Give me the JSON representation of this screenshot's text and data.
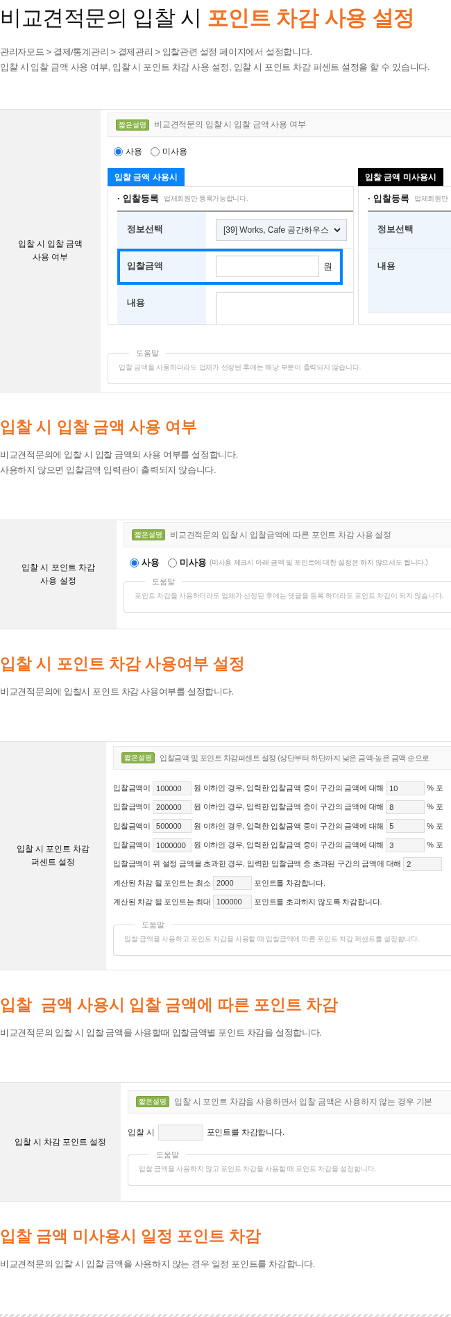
{
  "title": "비교견적문의 입찰 시 **포인트 차감 사용 설정**",
  "intro": [
    "관리자모드 > 결제/통계관리 > 결제관리 > 입찰관련 설정 페이지에서  설정합니다.",
    "입찰 시 입찰 금액 사용 여부, 입찰 시 포인트 차감 사용 설정, 입찰 시 포인트 차감 퍼센트 설정을 할 수 있습니다."
  ],
  "sections": [
    {
      "panel": {
        "kind": "bid_form",
        "label": "입찰 시 입찰 금액\n사용 여부",
        "badge": "짧은설명",
        "summary": "비교견적문의 입찰 시 입찰 금액 사용 여부",
        "options": [
          {
            "label": "사용",
            "selected": true
          },
          {
            "label": "미사용",
            "selected": false
          }
        ],
        "forms": [
          {
            "tab": "입찰 금액 사용시",
            "color": "#0a84ff",
            "title": "· 입찰등록",
            "note": "업체회원만 등록가능합니다.",
            "rows": [
              {
                "kind": "select",
                "label": "정보선택",
                "value": "[39] Works, Cafe 공간하우스",
                "highlighted": false
              },
              {
                "kind": "amount",
                "label": "입찰금액",
                "unit": "원",
                "highlighted": true
              },
              {
                "kind": "textarea",
                "label": "내용",
                "highlighted": false
              }
            ]
          },
          {
            "tab": "입찰 금액 미사용시",
            "color": "#000000",
            "title": "· 입찰등록",
            "note": "업체회원만",
            "rows": [
              {
                "kind": "label",
                "label": "정보선택",
                "highlighted": false
              },
              {
                "kind": "label",
                "label": "내용",
                "highlighted": false
              }
            ]
          }
        ],
        "help": {
          "legend": "도움말",
          "text": "입찰 금액을 사용하더라도 업체가 선정된 후에는 해당 부분이 출력되지 않습니다."
        }
      },
      "heading": "입찰 시 입찰 금액 사용 여부",
      "description": [
        "비교견적문의에 입찰 시 입찰 금액의 사용 여부를 설정합니다.",
        "사용하지 않으면 입찰금액 입력란이 출력되지 않습니다."
      ]
    },
    {
      "panel": {
        "kind": "toggle",
        "label": "입찰 시 포인트 차감\n사용 설정",
        "badge": "짧은설명",
        "summary": "비교견적문의 입찰 시 입찰금액에 따른 포인트 차감 사용 설정",
        "options": [
          {
            "label": "사용",
            "selected": true
          },
          {
            "label": "미사용",
            "selected": false
          }
        ],
        "option_note": "(미사용 체크시 아래 금액 및 포인트에 대한 설정은 하지 않으셔도 됩니다.)",
        "help": {
          "legend": "도움말",
          "text": "포인트 차감을 사용하더라도 업체가 선정된 후에는 댓글을 등록 하더라도 포인트 차감이 되지 않습니다."
        }
      },
      "heading": "입찰 시 포인트 차감 사용여부 설정",
      "description": [
        "비교견적문의에 입찰시 포인트 차감 사용여부를 설정합니다."
      ]
    },
    {
      "panel": {
        "kind": "percent",
        "label": "입찰 시 포인트 차감\n퍼센트 설정",
        "badge": "짧은설명",
        "summary": "입찰금액 및 포인트 차감퍼센트 설정 (상단부터 하단까지 낮은 금액-높은 금액 순으로",
        "lines": [
          {
            "parts": [
              {
                "kind": "text",
                "text": "입찰금액이"
              },
              {
                "kind": "input",
                "value": "100000"
              },
              {
                "kind": "text",
                "text": "원 이하인 경우, 입력한 입찰금액 중이 구간의 금액에 대해"
              },
              {
                "kind": "input",
                "value": "10"
              },
              {
                "kind": "text",
                "text": "% 포"
              }
            ]
          },
          {
            "parts": [
              {
                "kind": "text",
                "text": "입찰금액이"
              },
              {
                "kind": "input",
                "value": "200000"
              },
              {
                "kind": "text",
                "text": "원 이하인 경우, 입력한 입찰금액 중이 구간의 금액에 대해"
              },
              {
                "kind": "input",
                "value": "8"
              },
              {
                "kind": "text",
                "text": "% 포"
              }
            ]
          },
          {
            "parts": [
              {
                "kind": "text",
                "text": "입찰금액이"
              },
              {
                "kind": "input",
                "value": "500000"
              },
              {
                "kind": "text",
                "text": "원 이하인 경우, 입력한 입찰금액 중이 구간의 금액에 대해"
              },
              {
                "kind": "input",
                "value": "5"
              },
              {
                "kind": "text",
                "text": "% 포"
              }
            ]
          },
          {
            "parts": [
              {
                "kind": "text",
                "text": "입찰금액이"
              },
              {
                "kind": "input",
                "value": "1000000"
              },
              {
                "kind": "text",
                "text": "원 이하인 경우, 입력한 입찰금액 중이 구간의 금액에 대해"
              },
              {
                "kind": "input",
                "value": "3"
              },
              {
                "kind": "text",
                "text": "% 포"
              }
            ]
          },
          {
            "parts": [
              {
                "kind": "text",
                "text": "입찰금액이 위 설정 금액을 초과한 경우, 입력한 입찰금액 중 초과된 구간의 금액에 대해"
              },
              {
                "kind": "input",
                "value": "2"
              }
            ]
          },
          {
            "parts": [
              {
                "kind": "text",
                "text": "계산된 차감 될 포인트는 최소"
              },
              {
                "kind": "input",
                "value": "2000"
              },
              {
                "kind": "text",
                "text": "포인트를 차감합니다."
              }
            ]
          },
          {
            "parts": [
              {
                "kind": "text",
                "text": "계산된 차감 될 포인트는 최대"
              },
              {
                "kind": "input",
                "value": "100000"
              },
              {
                "kind": "text",
                "text": "포인트를 초과하지 않도록 차감합니다."
              }
            ]
          }
        ],
        "help": {
          "legend": "도움말",
          "text": "입찰 금액을 사용하고 포인트 차감을 사용할 때 입찰금액에 따른 포인트 차감 퍼센트를 설정합니다."
        }
      },
      "heading": "입찰  금액 사용시 입찰 금액에 따른 포인트 차감",
      "description": [
        "비교견적문의 입찰 시 입찰 금액을 사용할때 입찰금액별 포인트 차감을 설정합니다."
      ]
    },
    {
      "panel": {
        "kind": "fixed",
        "label": "입찰 시 차감 포인트 설정",
        "badge": "짧은설명",
        "summary": "입찰 시 포인트 차감을 사용하면서 입찰 금액은 사용하지 않는 경우 기본",
        "lines": [
          {
            "parts": [
              {
                "kind": "text",
                "text": "입찰 시"
              },
              {
                "kind": "input"
              },
              {
                "kind": "text",
                "text": "포인트를 차감합니다."
              }
            ]
          }
        ],
        "help": {
          "legend": "도움말",
          "text": "입찰 금액을 사용하지 않고 포인트 차감을 사용할 때 포인트 차감을 설정합니다."
        }
      },
      "heading": "입찰 금액 미사용시 일정 포인트 차감",
      "description": [
        "비교견적문의 입찰 시 입찰 금액을 사용하지 않는 경우 일정 포인트를 차감합니다."
      ]
    }
  ]
}
